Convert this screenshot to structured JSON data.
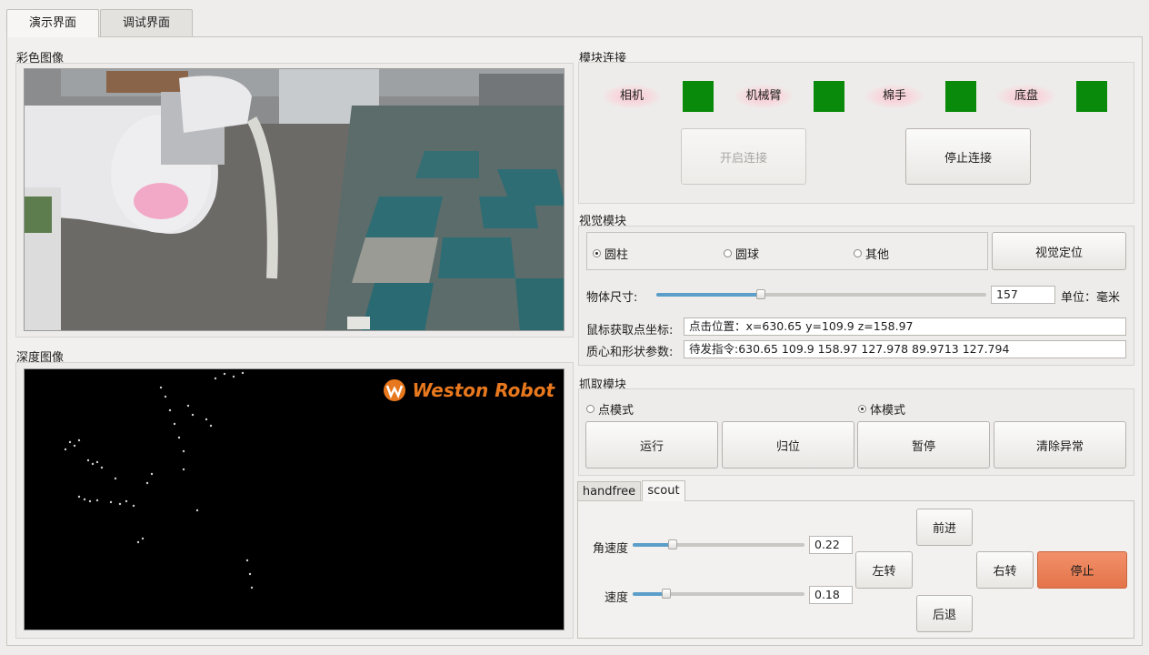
{
  "tabs": {
    "demo": "演示界面",
    "debug": "调试界面"
  },
  "left": {
    "color_title": "彩色图像",
    "depth_title": "深度图像",
    "logo_text": "Weston Robot"
  },
  "module_conn": {
    "title": "模块连接",
    "devices": [
      "相机",
      "机械臂",
      "棉手",
      "底盘"
    ],
    "status_color": "#0a8a0a",
    "open_btn": "开启连接",
    "stop_btn": "停止连接"
  },
  "vision": {
    "title": "视觉模块",
    "radios": [
      "圆柱",
      "圆球",
      "其他"
    ],
    "locate_btn": "视觉定位",
    "size_label": "物体尺寸:",
    "size_value": "157",
    "size_slider_fraction": 0.32,
    "unit_label": "单位：毫米",
    "mouse_label": "鼠标获取点坐标:",
    "mouse_value": "点击位置：x=630.65 y=109.9 z=158.97",
    "centroid_label": "质心和形状参数:",
    "centroid_value": "待发指令:630.65 109.9 158.97 127.978 89.9713 127.794"
  },
  "grab": {
    "title": "抓取模块",
    "mode_point": "点模式",
    "mode_body": "体模式",
    "buttons": [
      "运行",
      "归位",
      "暂停",
      "清除异常"
    ]
  },
  "chassis": {
    "tabs": [
      "handfree",
      "scout"
    ],
    "ang_label": "角速度",
    "ang_value": "0.22",
    "ang_slider_fraction": 0.22,
    "speed_label": "速度",
    "speed_value": "0.18",
    "speed_slider_fraction": 0.18,
    "forward": "前进",
    "back": "后退",
    "left": "左转",
    "right": "右转",
    "stop": "停止"
  }
}
